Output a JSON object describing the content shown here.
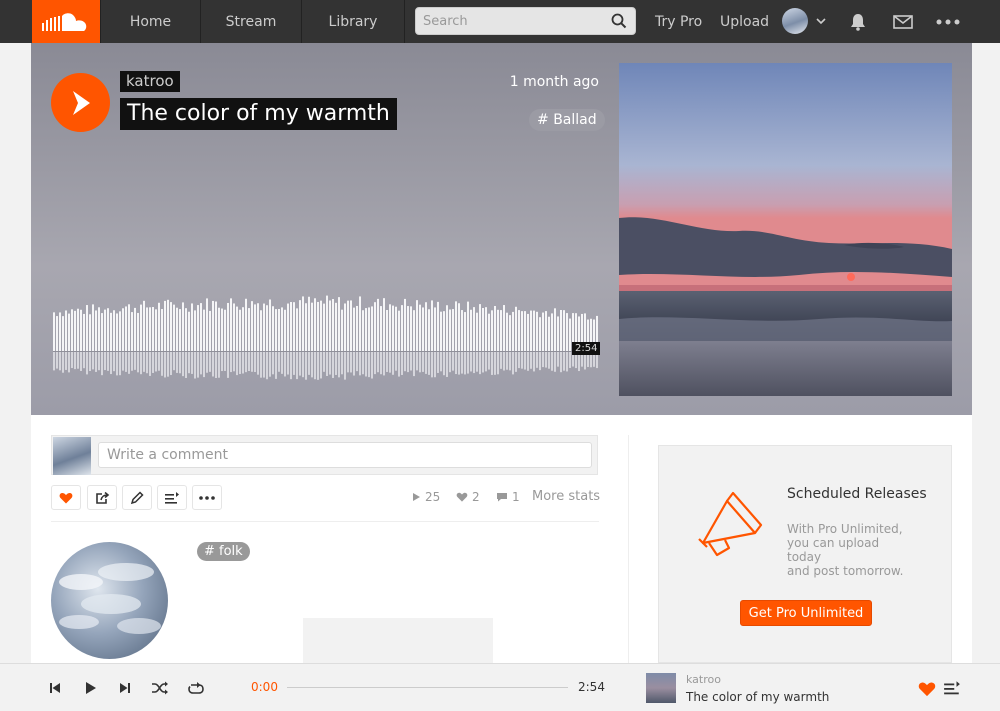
{
  "nav": {
    "home": "Home",
    "stream": "Stream",
    "library": "Library",
    "search_placeholder": "Search",
    "try_pro": "Try Pro",
    "upload": "Upload"
  },
  "track": {
    "user": "katroo",
    "title": "The color of my warmth",
    "posted": "1 month ago",
    "genre_tag": "Ballad",
    "duration": "2:54"
  },
  "comment": {
    "placeholder": "Write a comment"
  },
  "stats": {
    "plays": "25",
    "likes": "2",
    "comments": "1",
    "more": "More stats"
  },
  "description": {
    "tag": "folk"
  },
  "promo": {
    "title": "Scheduled Releases",
    "body_line1": "With Pro Unlimited,",
    "body_line2": "you can upload",
    "body_line3": "today",
    "body_line4": "and post tomorrow.",
    "button": "Get Pro Unlimited"
  },
  "player": {
    "elapsed": "0:00",
    "duration": "2:54",
    "user": "katroo",
    "title": "The color of my warmth"
  },
  "colors": {
    "accent": "#ff5500",
    "topbar": "#333333"
  }
}
